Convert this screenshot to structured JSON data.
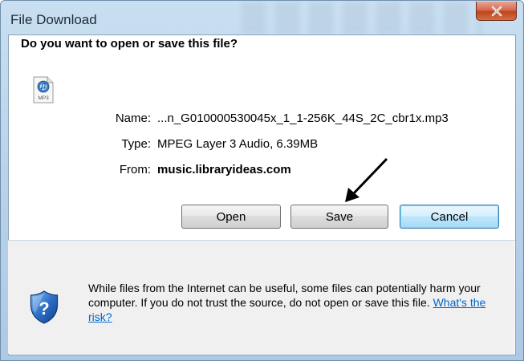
{
  "window": {
    "title": "File Download",
    "close_label": "Close"
  },
  "dialog": {
    "question": "Do you want to open or save this file?",
    "file": {
      "icon": "mp3-file-icon",
      "icon_caption": "MP3",
      "name_label": "Name:",
      "name_value": "...n_G010000530045x_1_1-256K_44S_2C_cbr1x.mp3",
      "type_label": "Type:",
      "type_value": "MPEG Layer 3 Audio, 6.39MB",
      "from_label": "From:",
      "from_value": "music.libraryideas.com"
    },
    "buttons": {
      "open": "Open",
      "save": "Save",
      "cancel": "Cancel"
    },
    "footer": {
      "icon": "security-shield-icon",
      "warning_text": "While files from the Internet can be useful, some files can potentially harm your computer. If you do not trust the source, do not open or save this file. ",
      "risk_link": "What's the risk?"
    }
  },
  "colors": {
    "title_bar": "#bcd4ec",
    "close_button": "#c9523a",
    "default_button_border": "#3c7fb1",
    "link": "#0066cc",
    "footer_bg": "#f0f0f0"
  }
}
